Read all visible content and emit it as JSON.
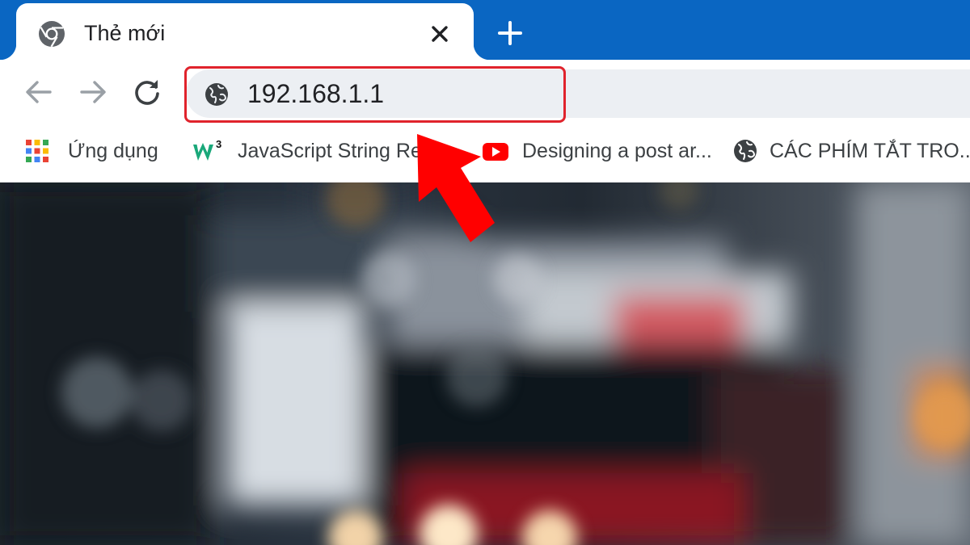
{
  "tab": {
    "title": "Thẻ mới",
    "favicon": "chrome-icon"
  },
  "toolbar": {
    "back_icon": "arrow-left-icon",
    "forward_icon": "arrow-right-icon",
    "reload_icon": "reload-icon",
    "site_icon": "globe-icon",
    "address_value": "192.168.1.1"
  },
  "bookmarks": [
    {
      "label": "Ứng dụng",
      "icon": "apps-grid-icon"
    },
    {
      "label": "JavaScript String Re...",
      "icon": "w3-logo-icon"
    },
    {
      "label": "Designing a post ar...",
      "icon": "youtube-icon"
    },
    {
      "label": "CÁC PHÍM TẮT TRO...",
      "icon": "globe-icon"
    }
  ],
  "colors": {
    "tabstrip": "#0a66c2",
    "highlight": "#e0232c",
    "arrow": "#ff0000"
  }
}
